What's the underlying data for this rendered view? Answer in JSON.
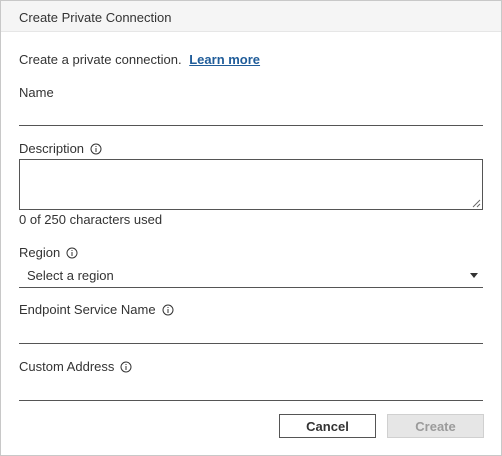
{
  "dialog": {
    "title": "Create Private Connection",
    "intro_text": "Create a private connection.",
    "learn_more_label": "Learn more"
  },
  "fields": {
    "name": {
      "label": "Name",
      "value": ""
    },
    "description": {
      "label": "Description",
      "value": "",
      "counter": "0 of 250 characters used"
    },
    "region": {
      "label": "Region",
      "selected": "Select a region"
    },
    "endpoint_service_name": {
      "label": "Endpoint Service Name",
      "value": ""
    },
    "custom_address": {
      "label": "Custom Address",
      "value": ""
    }
  },
  "buttons": {
    "cancel_label": "Cancel",
    "create_label": "Create"
  },
  "icons": {
    "info": "info-icon",
    "dropdown": "caret-down-icon",
    "resize": "resize-grip-icon"
  },
  "colors": {
    "link": "#1f5c99",
    "header_bg": "#f5f5f5",
    "disabled_button_bg": "#e6e6e6",
    "disabled_button_text": "#9b9b9b"
  }
}
